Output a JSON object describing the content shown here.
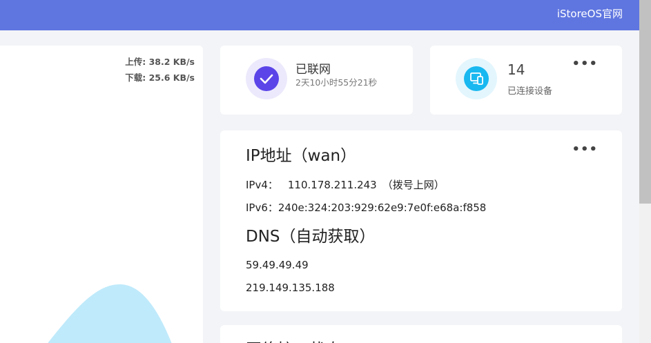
{
  "topbar": {
    "site_link": "iStoreOS官网"
  },
  "traffic": {
    "upload_text": "上传: 38.2 KB/s",
    "download_text": "下载: 25.6 KB/s"
  },
  "status": {
    "title": "已联网",
    "uptime": "2天10小时55分21秒"
  },
  "devices": {
    "count": "14",
    "label": "已连接设备",
    "more": "•••"
  },
  "ip_info": {
    "title": "IP地址（wan）",
    "ipv4_label": "IPv4：",
    "ipv4_value": "110.178.211.243",
    "ipv4_mode": "（拨号上网）",
    "ipv6_label": "IPv6：",
    "ipv6_value": "240e:324:203:929:62e9:7e0f:e68a:f858",
    "dns_title": "DNS（自动获取）",
    "dns": [
      "59.49.49.49",
      "219.149.135.188"
    ],
    "more": "•••"
  },
  "next_section": {
    "title": "网络接口状态"
  },
  "colors": {
    "topbar": "#5f76e0",
    "status_accent": "#5b45e8",
    "devices_accent": "#19b8f0",
    "traffic_area": "#bfeafb"
  },
  "icons": {
    "status": "check-circle-icon",
    "devices": "devices-icon",
    "more": "more-dots-icon"
  }
}
